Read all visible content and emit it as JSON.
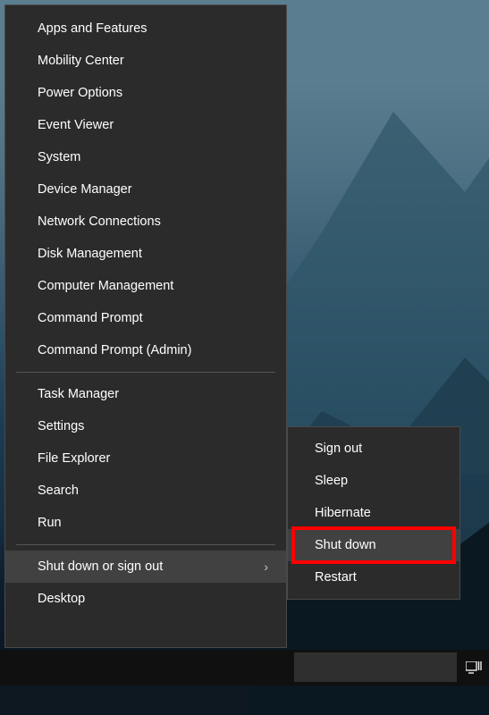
{
  "winx_menu": {
    "groups": [
      {
        "items": [
          {
            "name": "apps-and-features",
            "label": "Apps and Features"
          },
          {
            "name": "mobility-center",
            "label": "Mobility Center"
          },
          {
            "name": "power-options",
            "label": "Power Options"
          },
          {
            "name": "event-viewer",
            "label": "Event Viewer"
          },
          {
            "name": "system",
            "label": "System"
          },
          {
            "name": "device-manager",
            "label": "Device Manager"
          },
          {
            "name": "network-connections",
            "label": "Network Connections"
          },
          {
            "name": "disk-management",
            "label": "Disk Management"
          },
          {
            "name": "computer-management",
            "label": "Computer Management"
          },
          {
            "name": "command-prompt",
            "label": "Command Prompt"
          },
          {
            "name": "command-prompt-admin",
            "label": "Command Prompt (Admin)"
          }
        ]
      },
      {
        "items": [
          {
            "name": "task-manager",
            "label": "Task Manager"
          },
          {
            "name": "settings",
            "label": "Settings"
          },
          {
            "name": "file-explorer",
            "label": "File Explorer"
          },
          {
            "name": "search",
            "label": "Search"
          },
          {
            "name": "run",
            "label": "Run"
          }
        ]
      },
      {
        "items": [
          {
            "name": "shutdown-signout",
            "label": "Shut down or sign out",
            "has_submenu": true,
            "highlighted": true
          },
          {
            "name": "desktop",
            "label": "Desktop"
          }
        ]
      }
    ]
  },
  "submenu": {
    "items": [
      {
        "name": "sign-out",
        "label": "Sign out"
      },
      {
        "name": "sleep",
        "label": "Sleep"
      },
      {
        "name": "hibernate",
        "label": "Hibernate"
      },
      {
        "name": "shut-down",
        "label": "Shut down",
        "highlighted": true,
        "red_annotation": true
      },
      {
        "name": "restart",
        "label": "Restart"
      }
    ]
  }
}
